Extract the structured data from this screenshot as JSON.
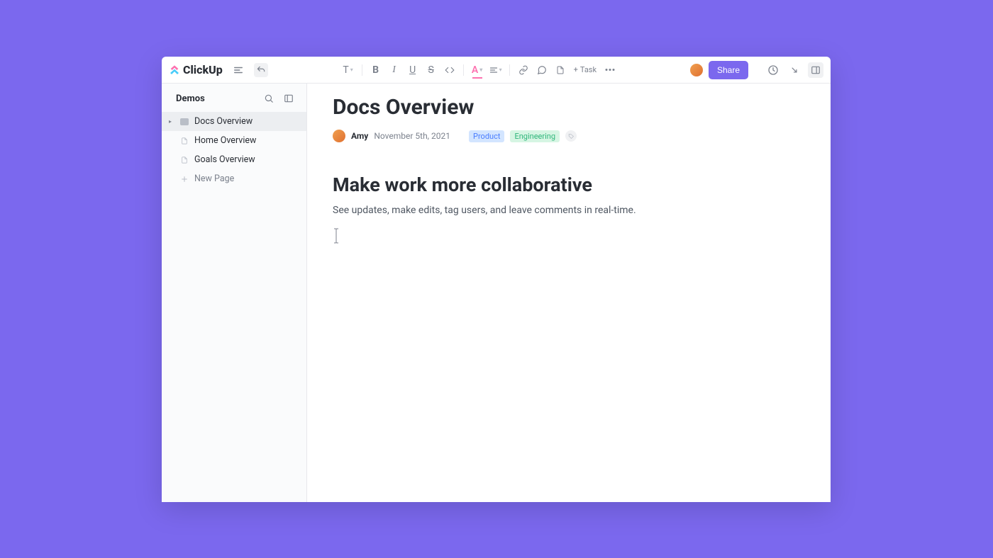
{
  "brand": {
    "name": "ClickUp"
  },
  "toolbar": {
    "text_style_letter": "T",
    "bold": "B",
    "italic": "I",
    "underline": "U",
    "strike": "S",
    "code": "</>",
    "text_color": "A",
    "task_label": "Task",
    "share_label": "Share"
  },
  "sidebar": {
    "title": "Demos",
    "items": [
      {
        "label": "Docs Overview",
        "type": "filled",
        "active": true
      },
      {
        "label": "Home Overview",
        "type": "doc",
        "active": false
      },
      {
        "label": "Goals Overview",
        "type": "doc",
        "active": false
      }
    ],
    "new_page_label": "New Page"
  },
  "document": {
    "title": "Docs Overview",
    "author": "Amy",
    "date": "November 5th, 2021",
    "tags": [
      {
        "label": "Product",
        "class": "product"
      },
      {
        "label": "Engineering",
        "class": "engineering"
      }
    ],
    "heading1": "Make work more collaborative",
    "paragraph1": "See updates, make edits, tag users, and leave comments in real-time."
  }
}
